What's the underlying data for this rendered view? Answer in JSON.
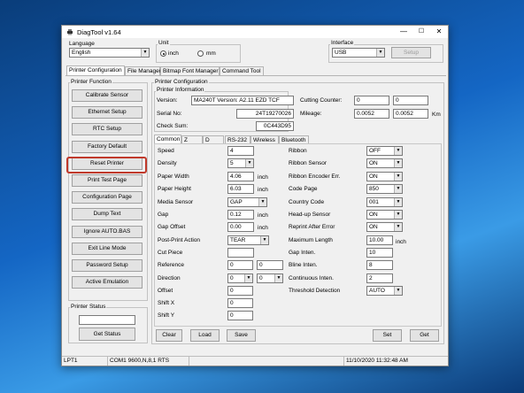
{
  "window": {
    "title": "DiagTool v1.64",
    "min": "—",
    "max": "☐",
    "close": "✕"
  },
  "language": {
    "label": "Language",
    "value": "English"
  },
  "unit": {
    "label": "Unit",
    "inch": "inch",
    "mm": "mm",
    "selected": "inch"
  },
  "interface": {
    "label": "Interface",
    "value": "USB",
    "setup": "Setup"
  },
  "main_tabs": [
    "Printer Configuration",
    "File Manager",
    "Bitmap Font Manager",
    "Command Tool"
  ],
  "printer_function": {
    "title": "Printer Function",
    "buttons": [
      "Calibrate Sensor",
      "Ethernet Setup",
      "RTC Setup",
      "Factory Default",
      "Reset Printer",
      "Print Test Page",
      "Configuration Page",
      "Dump Text",
      "Ignore AUTO.BAS",
      "Exit Line Mode",
      "Password Setup",
      "Active Emulation"
    ]
  },
  "printer_status": {
    "title": "Printer Status",
    "value": "",
    "button": "Get Status"
  },
  "printer_configuration": {
    "title": "Printer Configuration",
    "info_title": "Printer Information",
    "version_label": "Version:",
    "version": "MA240T Version: A2.11 EZD TCF",
    "serial_label": "Serial No:",
    "serial": "24T19270026",
    "checksum_label": "Check Sum:",
    "checksum": "0C443D95",
    "cutting_label": "Cutting Counter:",
    "cutting_a": "0",
    "cutting_b": "0",
    "mileage_label": "Mileage:",
    "mileage_a": "0.0052",
    "mileage_b": "0.0052",
    "mileage_unit": "Km"
  },
  "sub_tabs": [
    "Common",
    "Z",
    "D",
    "RS-232",
    "Wireless",
    "Bluetooth"
  ],
  "common_left": {
    "speed": {
      "label": "Speed",
      "value": "4"
    },
    "density": {
      "label": "Density",
      "value": "5"
    },
    "paper_width": {
      "label": "Paper Width",
      "value": "4.06",
      "unit": "inch"
    },
    "paper_height": {
      "label": "Paper Height",
      "value": "6.03",
      "unit": "inch"
    },
    "media_sensor": {
      "label": "Media Sensor",
      "value": "GAP"
    },
    "gap": {
      "label": "Gap",
      "value": "0.12",
      "unit": "inch"
    },
    "gap_offset": {
      "label": "Gap Offset",
      "value": "0.00",
      "unit": "inch"
    },
    "post_print": {
      "label": "Post-Print Action",
      "value": "TEAR"
    },
    "cut_piece": {
      "label": "Cut Piece",
      "value": ""
    },
    "reference": {
      "label": "Reference",
      "x": "0",
      "y": "0"
    },
    "direction": {
      "label": "Direction",
      "a": "0",
      "b": "0"
    },
    "offset": {
      "label": "Offset",
      "value": "0"
    },
    "shift_x": {
      "label": "Shift X",
      "value": "0"
    },
    "shift_y": {
      "label": "Shift Y",
      "value": "0"
    }
  },
  "common_right": {
    "ribbon": {
      "label": "Ribbon",
      "value": "OFF"
    },
    "ribbon_sensor": {
      "label": "Ribbon Sensor",
      "value": "ON"
    },
    "ribbon_encoder": {
      "label": "Ribbon Encoder Err.",
      "value": "ON"
    },
    "code_page": {
      "label": "Code Page",
      "value": "850"
    },
    "country_code": {
      "label": "Country Code",
      "value": "001"
    },
    "head_up": {
      "label": "Head-up Sensor",
      "value": "ON"
    },
    "reprint": {
      "label": "Reprint After Error",
      "value": "ON"
    },
    "max_length": {
      "label": "Maximum Length",
      "value": "10.00",
      "unit": "inch"
    },
    "gap_inten": {
      "label": "Gap Inten.",
      "value": "10"
    },
    "bline_inten": {
      "label": "Bline Inten.",
      "value": "8"
    },
    "cont_inten": {
      "label": "Continuous Inten.",
      "value": "2"
    },
    "threshold": {
      "label": "Threshold Detection",
      "value": "AUTO"
    }
  },
  "actions": {
    "clear": "Clear",
    "load": "Load",
    "save": "Save",
    "set": "Set",
    "get": "Get"
  },
  "status_bar": {
    "port": "LPT1",
    "comm": "COM1 9600,N,8,1 RTS",
    "datetime": "11/10/2020 11:32:48 AM"
  },
  "colors": {
    "highlight": "#c0392b",
    "desktop": "#1466c4"
  }
}
